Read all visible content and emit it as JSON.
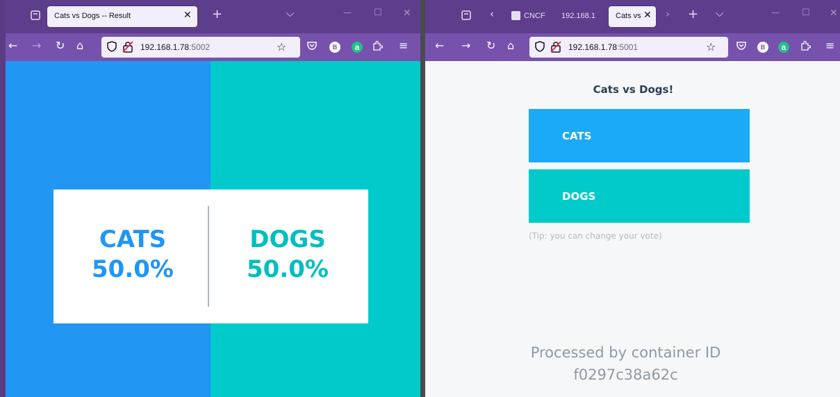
{
  "left_window": {
    "tab_title": "Cats vs Dogs -- Result",
    "tab_close": "✕",
    "new_tab": "+",
    "tab_list": "⌵",
    "url_host": "192.168.1.78",
    "url_port": ":5002",
    "result": {
      "cats_label": "CATS",
      "cats_pct": "50.0%",
      "dogs_label": "DOGS",
      "dogs_pct": "50.0%"
    },
    "colors": {
      "cats": "#2196f3",
      "dogs": "#00cbca"
    }
  },
  "right_window": {
    "tabs": [
      {
        "label": "CNCF"
      },
      {
        "label": "192.168.1"
      },
      {
        "label": "Cats vs"
      }
    ],
    "tab_close": "✕",
    "new_tab": "+",
    "tab_list": "⌵",
    "url_host": "192.168.1.78",
    "url_port": ":5001",
    "vote": {
      "title": "Cats vs Dogs!",
      "cats_button": "CATS",
      "dogs_button": "DOGS",
      "tip": "(Tip: you can change your vote)",
      "processed_line1": "Processed by container ID",
      "container_id": "f0297c38a62c"
    }
  },
  "toolbar": {
    "back": "←",
    "forward": "→",
    "reload": "↻",
    "home": "⌂",
    "bookmark_star": "☆",
    "extension_b": "B",
    "extension_a": "a",
    "menu": "≡",
    "minimize": "—",
    "maximize": "☐",
    "close": "✕"
  }
}
